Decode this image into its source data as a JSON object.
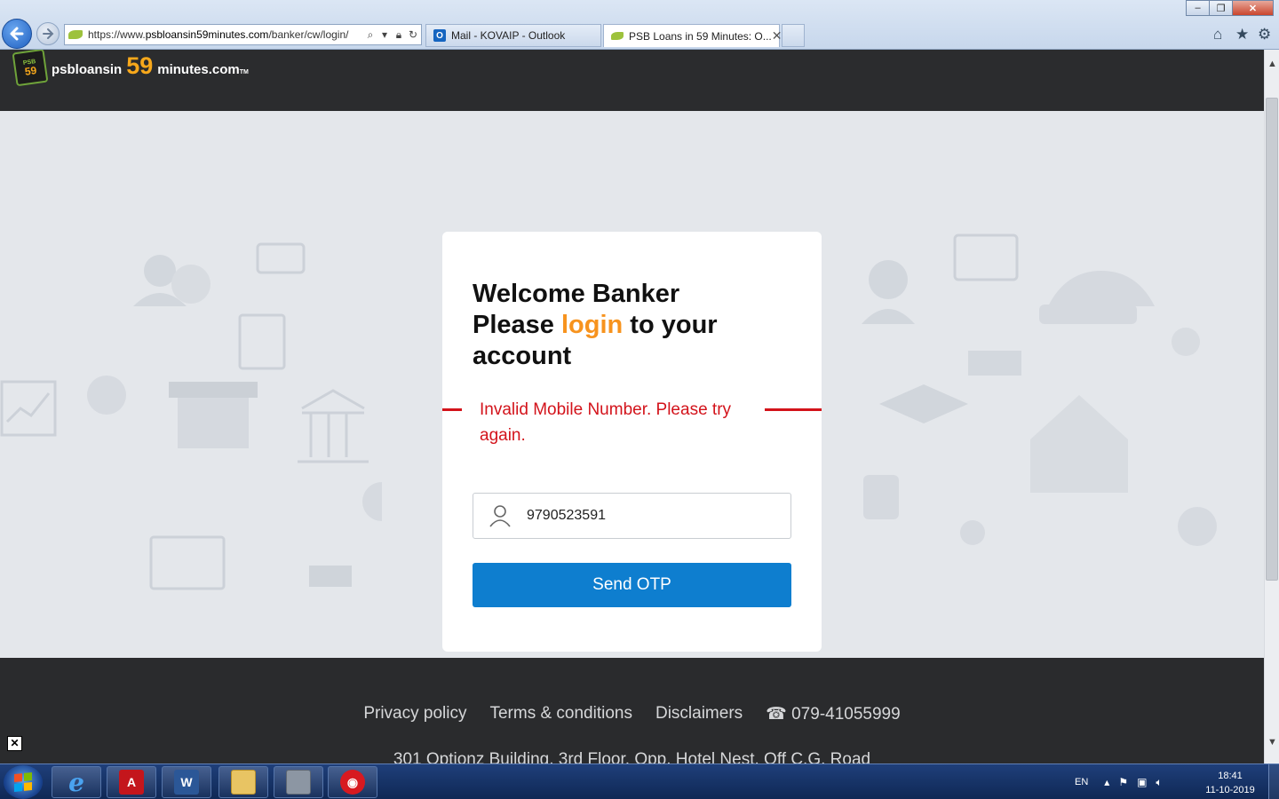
{
  "browser": {
    "url_prefix": "https://www.",
    "url_domain": "psbloansin59minutes.com",
    "url_path": "/banker/cw/login/",
    "tabs": [
      {
        "label": "Mail - KOVAIP - Outlook"
      },
      {
        "label": "PSB Loans in 59 Minutes: O..."
      }
    ],
    "window_buttons": {
      "minimize": "–",
      "maximize": "❐",
      "close": "✕"
    }
  },
  "header": {
    "logo": {
      "badge_top": "PSB",
      "badge_num": "59",
      "text_left": "psbloansin",
      "text_num": "59",
      "text_right": "minutes.com",
      "tm": "TM"
    }
  },
  "login": {
    "line1": "Welcome Banker",
    "line2_pre": "Please ",
    "line2_highlight": "login",
    "line2_post": " to your",
    "line3": "account",
    "error": "Invalid Mobile Number. Please try again.",
    "mobile_value": "9790523591",
    "send_otp": "Send OTP"
  },
  "footer": {
    "links": [
      "Privacy policy",
      "Terms & conditions",
      "Disclaimers"
    ],
    "phone": "☎ 079-41055999",
    "address": "301 Optionz Building, 3rd Floor, Opp. Hotel Nest, Off C.G. Road"
  },
  "colors": {
    "accent": "#f7931e",
    "button": "#0e7ecf",
    "error": "#d3131b",
    "header_bg": "#2b2c2e"
  },
  "taskbar": {
    "apps": [
      "internet-explorer",
      "adobe-acrobat",
      "microsoft-word",
      "file-explorer",
      "calculator",
      "trend-micro"
    ],
    "lang": "EN",
    "time": "18:41",
    "date": "11-10-2019"
  }
}
